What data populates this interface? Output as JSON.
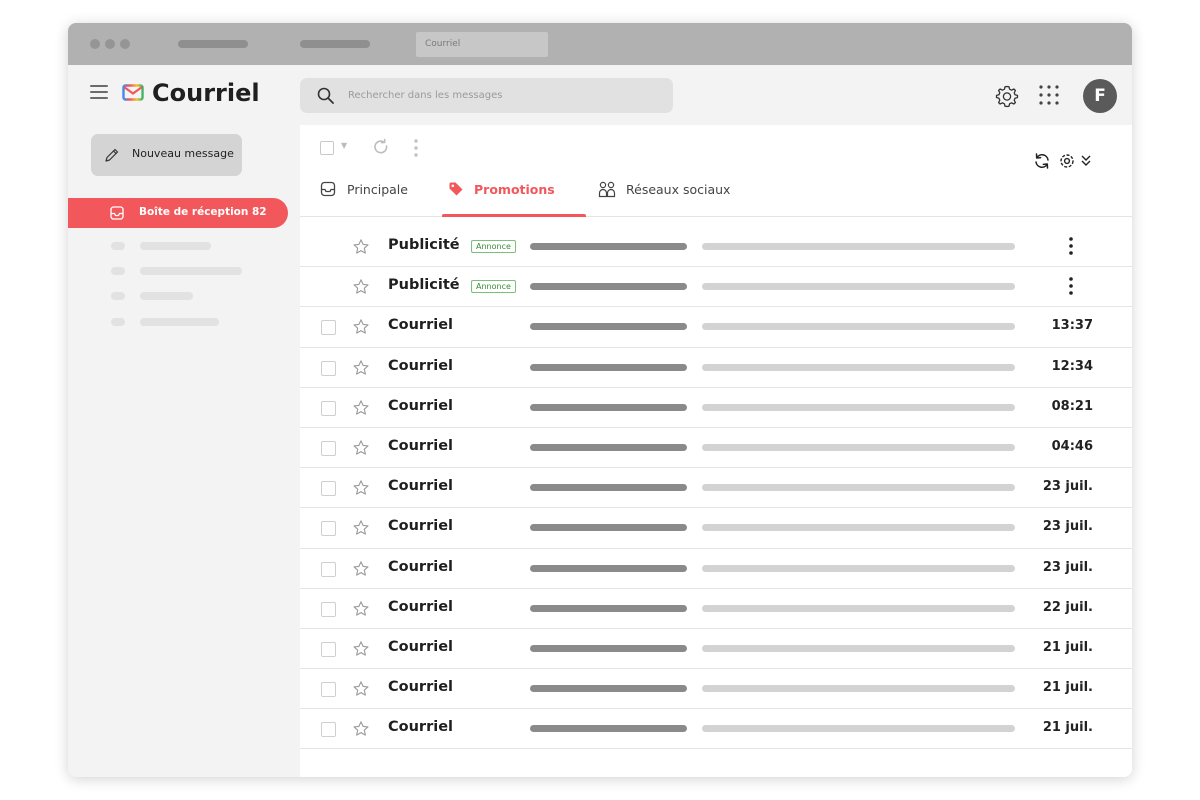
{
  "browser": {
    "tab_title": "Courriel"
  },
  "header": {
    "app_title": "Courriel",
    "search_placeholder": "Rechercher dans les messages",
    "avatar_letter": "F"
  },
  "sidebar": {
    "compose_label": "Nouveau message",
    "inbox_label": "Boîte de réception",
    "inbox_count": "82"
  },
  "tabs": [
    {
      "label": "Principale",
      "icon": "inbox-icon"
    },
    {
      "label": "Promotions",
      "icon": "tag-icon",
      "active": true
    },
    {
      "label": "Réseaux sociaux",
      "icon": "people-icon"
    }
  ],
  "ads": [
    {
      "sender": "Publicité",
      "badge": "Annonce"
    },
    {
      "sender": "Publicité",
      "badge": "Annonce"
    }
  ],
  "emails": [
    {
      "sender": "Courriel",
      "time": "13:37"
    },
    {
      "sender": "Courriel",
      "time": "12:34"
    },
    {
      "sender": "Courriel",
      "time": "08:21"
    },
    {
      "sender": "Courriel",
      "time": "04:46"
    },
    {
      "sender": "Courriel",
      "time": "23 juil."
    },
    {
      "sender": "Courriel",
      "time": "23 juil."
    },
    {
      "sender": "Courriel",
      "time": "23 juil."
    },
    {
      "sender": "Courriel",
      "time": "22 juil."
    },
    {
      "sender": "Courriel",
      "time": "21 juil."
    },
    {
      "sender": "Courriel",
      "time": "21 juil."
    },
    {
      "sender": "Courriel",
      "time": "21 juil."
    }
  ],
  "colors": {
    "accent": "#f2575b",
    "ad_badge": "#3b8a3b"
  }
}
